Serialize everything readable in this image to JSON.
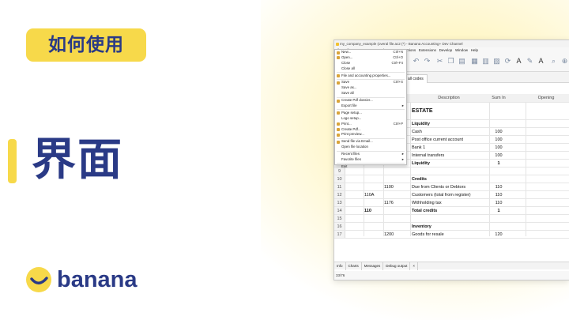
{
  "slide": {
    "badge": "如何使用",
    "title": "界面",
    "logo_text": "banana",
    "brand_color": "#2a3a86",
    "accent_color": "#f7d94a"
  },
  "window": {
    "title": "my_company_example (overal file.ac2 (*) - Banana Accounting+ Dev Channel",
    "menus": [
      "File",
      "Edit",
      "Data",
      "Format",
      "Tools",
      "Reports",
      "Actions",
      "Extensions",
      "Develop",
      "Window",
      "Help"
    ],
    "sheet_tab": "all codes"
  },
  "file_menu": {
    "items": [
      {
        "label": "New...",
        "shortcut": "Ctrl+N"
      },
      {
        "label": "Open...",
        "shortcut": "Ctrl+O"
      },
      {
        "label": "Close",
        "shortcut": "Ctrl+F4"
      },
      {
        "label": "Close all",
        "shortcut": ""
      },
      {
        "label": "File and accounting properties...",
        "shortcut": ""
      },
      {
        "label": "Save",
        "shortcut": "Ctrl+S"
      },
      {
        "label": "Save as...",
        "shortcut": ""
      },
      {
        "label": "Save all",
        "shortcut": ""
      },
      {
        "label": "Create Pdf dossier...",
        "shortcut": ""
      },
      {
        "label": "Export file",
        "shortcut": "",
        "submenu": true
      },
      {
        "label": "Page setup...",
        "shortcut": ""
      },
      {
        "label": "Logo setup...",
        "shortcut": ""
      },
      {
        "label": "Print...",
        "shortcut": "Ctrl+P"
      },
      {
        "label": "Create Pdf...",
        "shortcut": ""
      },
      {
        "label": "Print preview...",
        "shortcut": ""
      },
      {
        "label": "Send file via Email...",
        "shortcut": ""
      },
      {
        "label": "Open file location",
        "shortcut": ""
      },
      {
        "label": "Recent files",
        "shortcut": "",
        "submenu": true
      },
      {
        "label": "Favorite files",
        "shortcut": "",
        "submenu": true
      },
      {
        "label": "Exit",
        "shortcut": ""
      }
    ]
  },
  "table": {
    "columns": [
      "Description",
      "Sum In",
      "Opening"
    ],
    "rows": [
      {
        "n": "",
        "g": "",
        "acc": "",
        "desc": "ESTATE",
        "sum": "",
        "bold": true,
        "big": true
      },
      {
        "n": "",
        "g": "",
        "acc": "",
        "desc": "Liquidity",
        "sum": "",
        "bold": true
      },
      {
        "n": "",
        "g": "",
        "acc": "",
        "desc": "Cash",
        "sum": "100"
      },
      {
        "n": "",
        "g": "",
        "acc": "",
        "desc": "Post office current account",
        "sum": "100"
      },
      {
        "n": "",
        "g": "",
        "acc": "",
        "desc": "Bank 1",
        "sum": "100"
      },
      {
        "n": "",
        "g": "",
        "acc": "",
        "desc": "Internal transfers",
        "sum": "100"
      },
      {
        "n": "8",
        "g": "100",
        "acc": "",
        "desc": "Liquidity",
        "sum": "1",
        "bold": true
      },
      {
        "n": "9",
        "g": "",
        "acc": "",
        "desc": "",
        "sum": ""
      },
      {
        "n": "10",
        "g": "",
        "acc": "",
        "desc": "Credits",
        "sum": "",
        "bold": true
      },
      {
        "n": "11",
        "g": "",
        "acc": "1100",
        "desc": "Due from Clients or Debtors",
        "sum": "110"
      },
      {
        "n": "12",
        "g": "110A",
        "acc": "",
        "desc": "Customers (total from register)",
        "sum": "110"
      },
      {
        "n": "13",
        "g": "",
        "acc": "1176",
        "desc": "Withholding tax",
        "sum": "110"
      },
      {
        "n": "14",
        "g": "110",
        "acc": "",
        "desc": "Total credits",
        "sum": "1",
        "bold": true
      },
      {
        "n": "15",
        "g": "",
        "acc": "",
        "desc": "",
        "sum": ""
      },
      {
        "n": "16",
        "g": "",
        "acc": "",
        "desc": "Inventory",
        "sum": "",
        "bold": true
      },
      {
        "n": "17",
        "g": "",
        "acc": "1200",
        "desc": "Goods for resale",
        "sum": "120"
      }
    ]
  },
  "bottom_tabs": [
    "Info",
    "Charts",
    "Messages",
    "Debug output"
  ],
  "status": "33/76"
}
